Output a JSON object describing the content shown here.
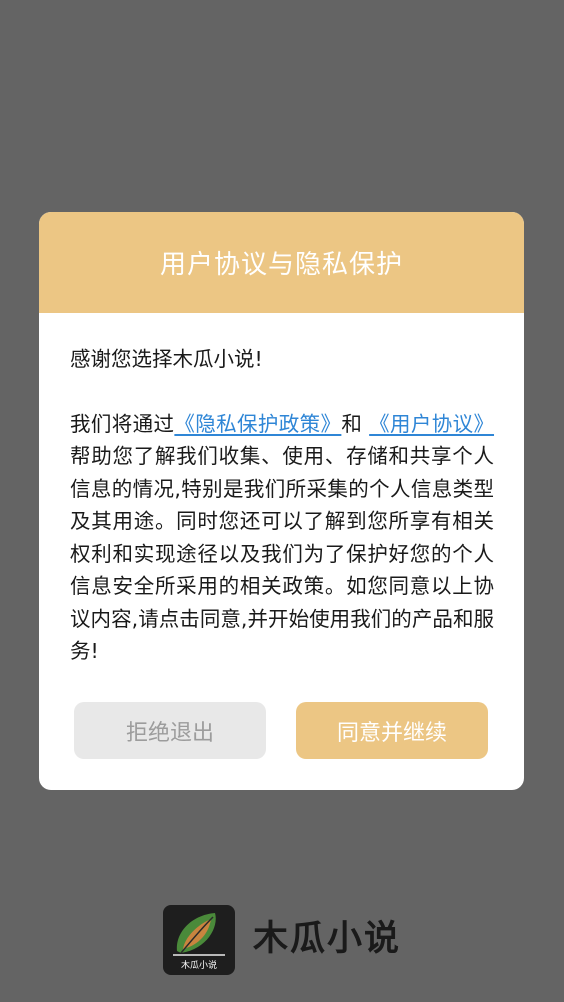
{
  "dialog": {
    "title": "用户协议与隐私保护",
    "greeting": "感谢您选择木瓜小说!",
    "intro_prefix": "我们将通过",
    "privacy_link": "《隐私保护政策》",
    "conjunction": "和 ",
    "user_agreement_link": "《用户协议》",
    "intro_body": "帮助您了解我们收集、使用、存储和共享个人信息的情况,特别是我们所采集的个人信息类型及其用途。同时您还可以了解到您所享有相关权利和实现途径以及我们为了保护好您的个人信息安全所采用的相关政策。如您同意以上协议内容,请点击同意,并开始使用我们的产品和服务!",
    "reject_label": "拒绝退出",
    "agree_label": "同意并继续"
  },
  "brand": {
    "logo_icon": "papaya-book-icon",
    "logo_caption": "木瓜小说",
    "name": "木瓜小说"
  },
  "colors": {
    "backdrop": "#646464",
    "accent": "#ecc684",
    "link": "#2f86d6",
    "reject_bg": "#e8e8e8",
    "reject_text": "#9c9c9c"
  }
}
